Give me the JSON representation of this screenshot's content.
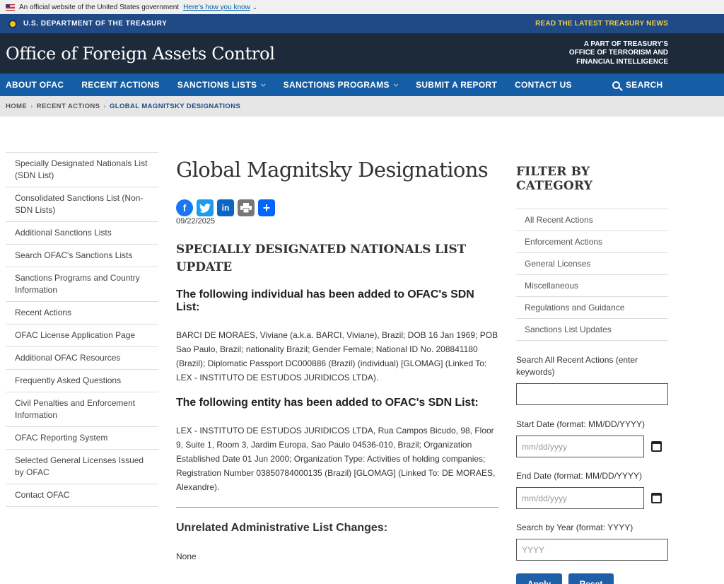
{
  "gov_banner": {
    "text": "An official website of the United States government",
    "link": "Here's how you know"
  },
  "treasury_bar": {
    "left": "U.S. DEPARTMENT OF THE TREASURY",
    "right": "READ THE LATEST TREASURY NEWS"
  },
  "header": {
    "title": "Office of Foreign Assets Control",
    "tagline_1": "A PART OF TREASURY'S",
    "tagline_2": "OFFICE OF TERRORISM AND",
    "tagline_3": "FINANCIAL INTELLIGENCE"
  },
  "nav": {
    "items": [
      "ABOUT OFAC",
      "RECENT ACTIONS",
      "SANCTIONS LISTS",
      "SANCTIONS PROGRAMS",
      "SUBMIT A REPORT",
      "CONTACT US"
    ],
    "search": "SEARCH"
  },
  "breadcrumb": {
    "home": "HOME",
    "recent": "RECENT ACTIONS",
    "current": "GLOBAL MAGNITSKY DESIGNATIONS"
  },
  "sidebar": {
    "items": [
      "Specially Designated Nationals List (SDN List)",
      "Consolidated Sanctions List (Non-SDN Lists)",
      "Additional Sanctions Lists",
      "Search OFAC's Sanctions Lists",
      "Sanctions Programs and Country Information",
      "Recent Actions",
      "OFAC License Application Page",
      "Additional OFAC Resources",
      "Frequently Asked Questions",
      "Civil Penalties and Enforcement Information",
      "OFAC Reporting System",
      "Selected General Licenses Issued by OFAC",
      "Contact OFAC"
    ]
  },
  "main": {
    "title": "Global Magnitsky Designations",
    "date": "09/22/2025",
    "sdn_heading": "SPECIALLY DESIGNATED NATIONALS LIST UPDATE",
    "individual_heading": "The following individual has been added to OFAC's SDN List:",
    "individual_text": "BARCI DE MORAES, Viviane (a.k.a. BARCI, Viviane), Brazil; DOB 16 Jan 1969; POB Sao Paulo, Brazil; nationality Brazil; Gender Female; National ID No. 208841180 (Brazil); Diplomatic Passport DC000886 (Brazil) (individual) [GLOMAG] (Linked To: LEX - INSTITUTO DE ESTUDOS JURIDICOS LTDA).",
    "entity_heading": "The following entity has been added to OFAC's SDN List:",
    "entity_text": "LEX - INSTITUTO DE ESTUDOS JURIDICOS LTDA, Rua Campos Bicudo, 98, Floor 9, Suite 1, Room 3, Jardim Europa, Sao Paulo 04536-010, Brazil; Organization Established Date 01 Jun 2000; Organization Type: Activities of holding companies; Registration Number 03850784000135 (Brazil) [GLOMAG] (Linked To: DE MORAES, Alexandre).",
    "unrelated_heading": "Unrelated Administrative List Changes:",
    "unrelated_text": "None"
  },
  "filter": {
    "title": "FILTER BY CATEGORY",
    "categories": [
      "All Recent Actions",
      "Enforcement Actions",
      "General Licenses",
      "Miscellaneous",
      "Regulations and Guidance",
      "Sanctions List Updates"
    ],
    "search_label": "Search All Recent Actions (enter keywords)",
    "search_value": "",
    "start_label": "Start Date (format: MM/DD/YYYY)",
    "start_placeholder": "mm/dd/yyyy",
    "end_label": "End Date (format: MM/DD/YYYY)",
    "end_placeholder": "mm/dd/yyyy",
    "year_label": "Search by Year (format: YYYY)",
    "year_placeholder": "YYYY",
    "apply": "Apply",
    "reset": "Reset"
  }
}
